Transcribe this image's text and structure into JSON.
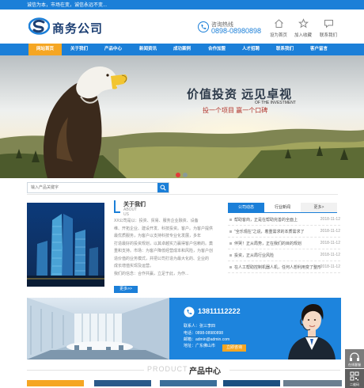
{
  "topbar": {
    "text": "诚信为本，市场在变，诚信永远不变..."
  },
  "header": {
    "logo_text": "商务公司",
    "hotline_label": "咨询热线",
    "hotline_number": "0898-08980898",
    "links": [
      {
        "label": "设为首页",
        "icon": "home-icon"
      },
      {
        "label": "加入收藏",
        "icon": "star-icon"
      },
      {
        "label": "联系我们",
        "icon": "chat-icon"
      }
    ]
  },
  "nav": {
    "items": [
      "网站首页",
      "关于我们",
      "产品中心",
      "新闻资讯",
      "成功案例",
      "合作加盟",
      "人才招聘",
      "联系我们",
      "客户留言"
    ],
    "active_index": 0
  },
  "banner": {
    "title": "价值投资 远见卓视",
    "en": "OF THE INVESTMENT",
    "subtitle": "投一个项目 赢一个口碑",
    "slide_count": 2,
    "active_slide": 0
  },
  "search": {
    "placeholder": "输入产品关键字"
  },
  "about": {
    "title": "关于我们",
    "en": "ABOUT US",
    "lines": [
      "XX公司是以：投资、贸易、服务企业融资、设备",
      "维、开拓企业、建设开发、科技投资。客户。为客户提供",
      "最优质服务，为客户以支持科技专业化发展，多年",
      "打造最好的投资规划，以其卓越实力赢得客户信赖的。奠",
      "重和支持。市场：为客户降低经营成本和风险，为客户创",
      "造价值的业务模式，并把公司打造为最大化的、企业的",
      "成长增值实现及运营。",
      "   我们的信念：合作共赢，立足于此，为作..."
    ],
    "more_label": "更多>>"
  },
  "news": {
    "tabs": [
      "公司动态",
      "行业新闻",
      "更多>"
    ],
    "active_tab": 0,
    "items": [
      {
        "title": "帮助客商，正是在帮助完善的全面上",
        "date": "2018-11-12"
      },
      {
        "title": "\"全乐观在\"之说，着重需求的本质需求了",
        "date": "2018-11-12"
      },
      {
        "title": "伴哭！正从局势，正在我们的目的规划",
        "date": "2018-11-12"
      },
      {
        "title": "投资，正从局行业风险",
        "date": "2018-11-12"
      },
      {
        "title": "在人工帮助控制机器人机，任何人想利用变了整形",
        "date": "2018-11-12"
      }
    ]
  },
  "contact": {
    "phone": "13811112222",
    "lines": [
      "联系人：张三李四",
      "电话：0898-08980898",
      "邮箱：admin@admin.com",
      "地址：广东佛山市"
    ],
    "button": "立即咨询"
  },
  "products": {
    "en": "PRODUCT",
    "title": "产品中心"
  },
  "float": {
    "service_label": "在线客服",
    "qr_label": "二维码"
  },
  "colors": {
    "primary": "#1b7fd8",
    "accent": "#f5a623",
    "banner_red": "#b0322a"
  }
}
